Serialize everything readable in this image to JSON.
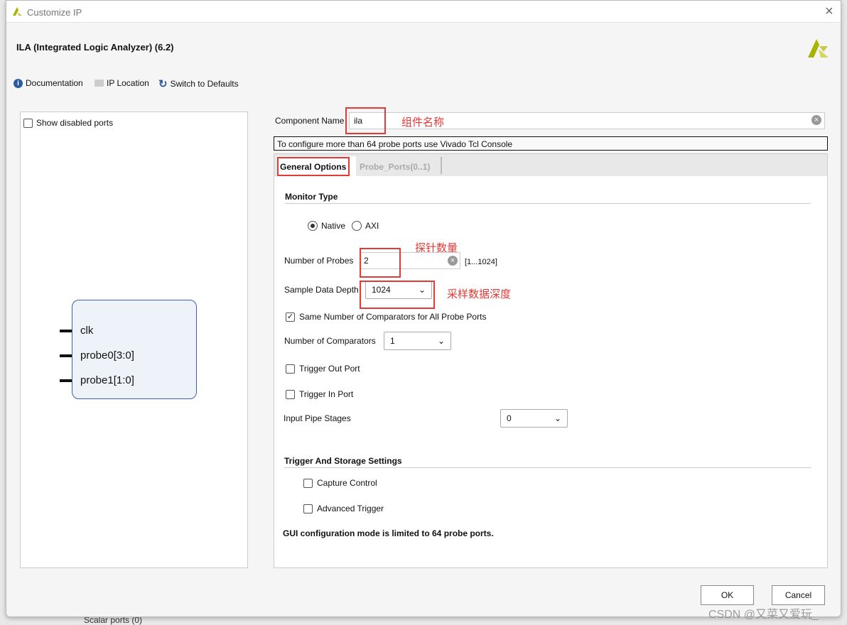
{
  "window": {
    "title": "Customize IP",
    "close": "×"
  },
  "header": {
    "title": "ILA (Integrated Logic Analyzer) (6.2)"
  },
  "toolbar": {
    "documentation": "Documentation",
    "ip_location": "IP Location",
    "switch_defaults": "Switch to Defaults"
  },
  "left": {
    "show_disabled": "Show disabled ports",
    "ports": [
      "clk",
      "probe0[3:0]",
      "probe1[1:0]"
    ]
  },
  "component": {
    "label": "Component Name",
    "value": "ila",
    "annotation": "组件名称"
  },
  "notice": "To configure more than 64 probe ports use Vivado Tcl Console",
  "tabs": [
    {
      "label": "General Options",
      "active": true
    },
    {
      "label": "Probe_Ports(0..1)",
      "active": false
    }
  ],
  "general": {
    "monitor_type": "Monitor Type",
    "native": "Native",
    "axi": "AXI",
    "monitor_selected": "Native",
    "num_probes_label": "Number of Probes",
    "num_probes": "2",
    "num_probes_range": "[1...1024]",
    "num_probes_annotation": "探针数量",
    "depth_label": "Sample Data Depth",
    "depth": "1024",
    "depth_annotation": "采样数据深度",
    "same_comparators": "Same Number of Comparators for All Probe Ports",
    "same_comparators_checked": true,
    "num_comp_label": "Number of Comparators",
    "num_comp": "1",
    "trigger_out": "Trigger Out Port",
    "trigger_in": "Trigger In Port",
    "pipe_label": "Input Pipe Stages",
    "pipe": "0",
    "trigger_storage": "Trigger And Storage Settings",
    "capture_control": "Capture Control",
    "advanced_trigger": "Advanced Trigger",
    "gui_note": "GUI configuration mode is limited to 64 probe ports."
  },
  "footer": {
    "ok": "OK",
    "cancel": "Cancel",
    "watermark": "CSDN @又菜又爱玩_"
  },
  "background": {
    "scalar_ports": "Scalar ports (0)"
  },
  "colors": {
    "annotation": "#e53935",
    "brand": "#a8b400"
  }
}
